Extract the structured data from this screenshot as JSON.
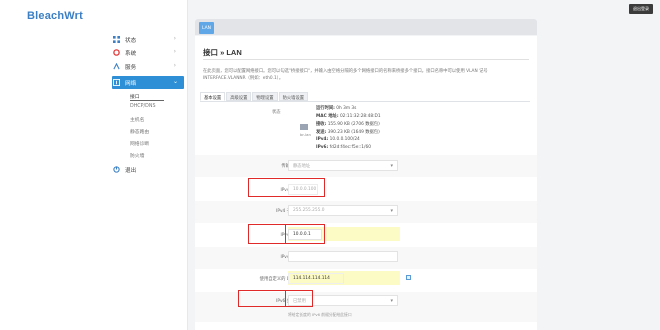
{
  "brand": "BleachWrt",
  "top_right_button": "退出登录",
  "top_tab": "LAN",
  "sidebar": {
    "items": [
      {
        "label": "状态",
        "icon": "grid-icon"
      },
      {
        "label": "系统",
        "icon": "gear-icon"
      },
      {
        "label": "服务",
        "icon": "services-icon"
      },
      {
        "label": "网络",
        "icon": "network-icon"
      }
    ],
    "sub_items": [
      "接口",
      "DHCP/DNS",
      "主机名",
      "静态路由",
      "网络诊断",
      "防火墙"
    ],
    "logout": "退出"
  },
  "page": {
    "title": "接口 » LAN",
    "description": "在此页面，您可以配置网络接口。您可以勾选\"桥接接口\"，并输入由空格分隔的多个网络接口的名称来桥接多个接口。接口名称中可以使用 VLAN 记号 INTERFACE.VLANNR（例如：eth0.1）。",
    "tabs": [
      "基本设置",
      "高级设置",
      "物理设置",
      "防火墙设置"
    ]
  },
  "status": {
    "label": "状态",
    "icon_label": "br-lan",
    "lines": [
      {
        "k": "运行时间:",
        "v": "0h 3m 3s"
      },
      {
        "k": "MAC 地址:",
        "v": "02:11:32:28:48:D1"
      },
      {
        "k": "接收:",
        "v": "155.90 KB (2706 数据包)"
      },
      {
        "k": "发送:",
        "v": "390.23 KB (1649 数据包)"
      },
      {
        "k": "IPv4:",
        "v": "10.0.0.100/24"
      },
      {
        "k": "IPv6:",
        "v": "fd2d:f4ec:f5e::1/60"
      }
    ]
  },
  "form": {
    "protocol": {
      "label": "传输协议",
      "value": "静态地址"
    },
    "ipv4_addr": {
      "label": "IPv4 地址",
      "value": "10.0.0.100"
    },
    "netmask": {
      "label": "IPv4 子网掩码",
      "value": "255.255.255.0"
    },
    "gateway": {
      "label": "IPv4 网关",
      "value": "10.0.0.1"
    },
    "broadcast": {
      "label": "IPv4 广播",
      "value": ""
    },
    "dns": {
      "label": "使用自定义的 DNS 服务器",
      "value": "114.114.114.114"
    },
    "ipv6_assign": {
      "label": "IPv6 分配长度",
      "value": "已禁用"
    },
    "ipv6_hint": "将给定长度的 IPv6 前缀分配给此接口"
  }
}
